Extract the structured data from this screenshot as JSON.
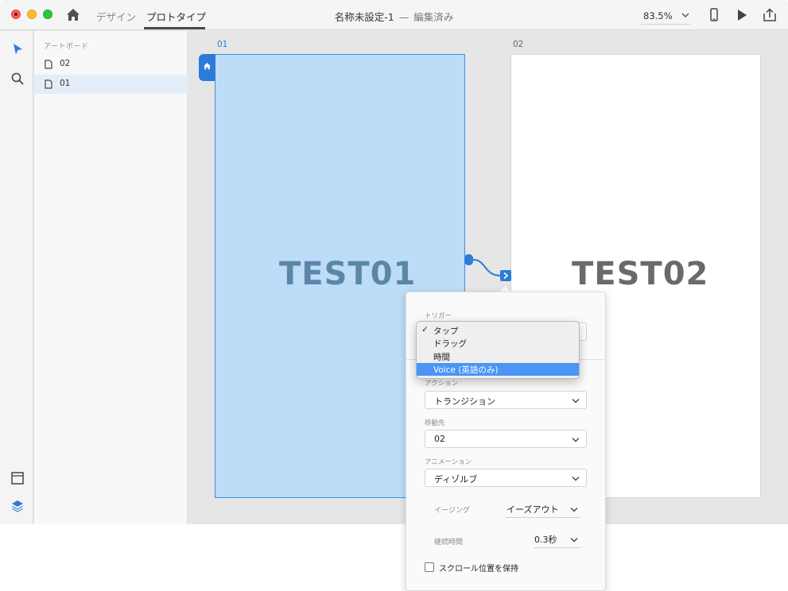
{
  "titlebar": {
    "tabs": {
      "design": "デザイン",
      "prototype": "プロトタイプ"
    },
    "document_title": "名称未設定-1",
    "separator": "—",
    "document_state": "編集済み",
    "zoom": "83.5%"
  },
  "layers": {
    "title": "アートボード",
    "items": [
      {
        "label": "02",
        "selected": false
      },
      {
        "label": "01",
        "selected": true
      }
    ]
  },
  "canvas": {
    "artboard1": {
      "label": "01",
      "text": "TEST01"
    },
    "artboard2": {
      "label": "02",
      "text": "TEST02"
    }
  },
  "inspector": {
    "trigger_label": "トリガー",
    "trigger_options": [
      {
        "label": "タップ",
        "checked": true
      },
      {
        "label": "ドラッグ",
        "checked": false
      },
      {
        "label": "時間",
        "checked": false
      },
      {
        "label": "Voice (英語のみ)",
        "checked": false,
        "highlighted": true
      }
    ],
    "checkmark": "✓",
    "action_label": "アクション",
    "action_value": "トランジション",
    "destination_label": "移動先",
    "destination_value": "02",
    "animation_label": "アニメーション",
    "animation_value": "ディゾルブ",
    "easing_label": "イージング",
    "easing_value": "イーズアウト",
    "duration_label": "継続時間",
    "duration_value": "0.3秒",
    "scroll_label": "スクロール位置を保持"
  },
  "colors": {
    "accent": "#2d7bd8",
    "artboard_fill": "#bcdcf7",
    "highlight": "#4a95f5"
  }
}
